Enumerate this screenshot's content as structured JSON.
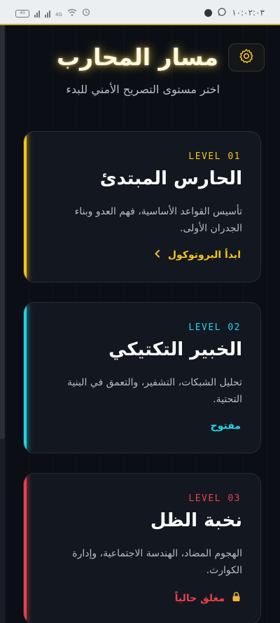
{
  "status_bar": {
    "time": "١٠:٠٢:٠٣",
    "battery": "40",
    "network": "4G"
  },
  "header": {
    "title": "مسار المحارب",
    "subtitle": "اختر مستوى التصريح الأمني للبدء"
  },
  "cards": [
    {
      "level": "LEVEL  01",
      "title": "الحارس المبتدئ",
      "description": "تأسيس القواعد الأساسية، فهم العدو وبناء الجدران الأولى.",
      "action": "ابدأ البروتوكول",
      "action_icon": "chevron-left-icon",
      "accent": "#f4c21a",
      "state": "start"
    },
    {
      "level": "LEVEL  02",
      "title": "الخبير التكتيكي",
      "description": "تحليل الشبكات، التشفير، والتعمق في البنية التحتية.",
      "action": "مفتوح",
      "accent": "#22d3e6",
      "state": "open"
    },
    {
      "level": "LEVEL  03",
      "title": "نخبة الظل",
      "description": "الهجوم المضاد، الهندسة الاجتماعية، وإدارة الكوارث.",
      "action": "مغلق حالياً",
      "action_icon": "lock-icon",
      "accent": "#e8404a",
      "state": "locked"
    }
  ]
}
